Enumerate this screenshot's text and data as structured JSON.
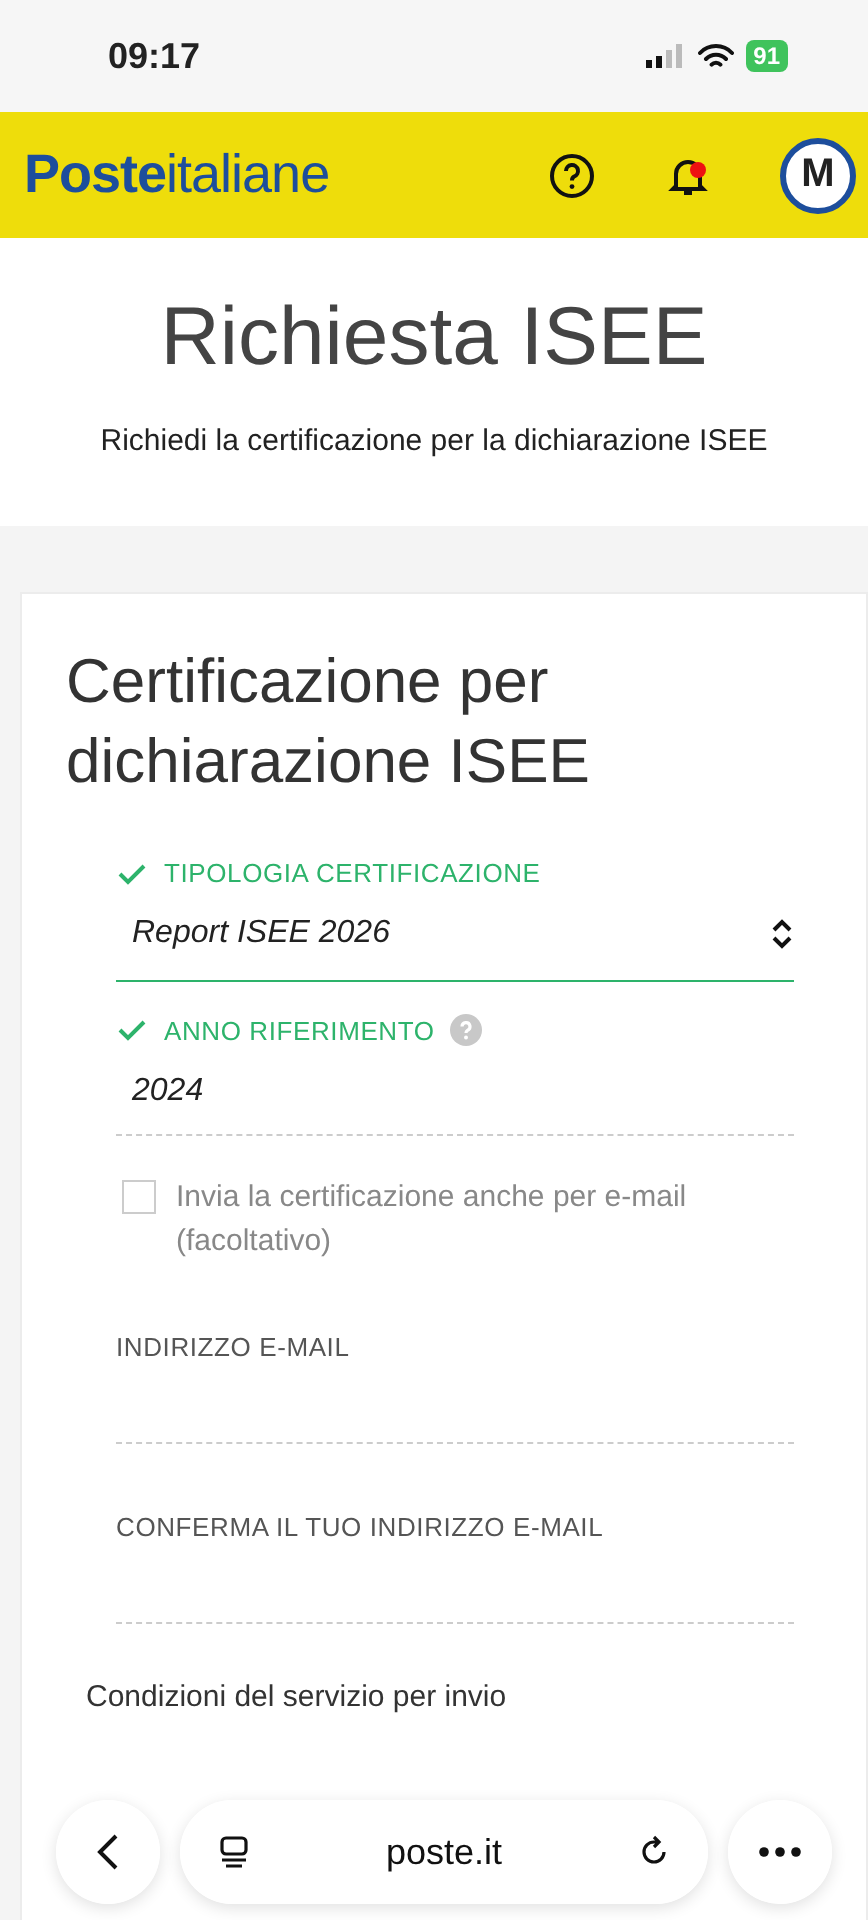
{
  "status_bar": {
    "time": "09:17",
    "battery": "91"
  },
  "header": {
    "logo": "**Poste**italiane",
    "avatar": "M",
    "notification_dot": true
  },
  "page": {
    "title": "Richiesta ISEE",
    "subtitle": "Richiedi la certificazione per la dichiarazione ISEE"
  },
  "card": {
    "title": "Certificazione per dichiarazione ISEE",
    "fields": [
      {
        "kind": "select",
        "label": "TIPOLOGIA CERTIFICAZIONE",
        "value": "Report ISEE 2026",
        "valid": true,
        "help": false
      },
      {
        "kind": "text",
        "label": "ANNO RIFERIMENTO",
        "value": "2024",
        "valid": true,
        "help": true
      }
    ],
    "email_option": {
      "label": "Invia la certificazione anche per e-mail (facoltativo)",
      "checked": false
    },
    "email_fields": [
      {
        "label": "INDIRIZZO E-MAIL"
      },
      {
        "label": "CONFERMA IL TUO INDIRIZZO E-MAIL"
      }
    ],
    "conditions_title": "Condizioni del servizio per invio"
  },
  "browser_bar": {
    "url": "poste.it"
  }
}
